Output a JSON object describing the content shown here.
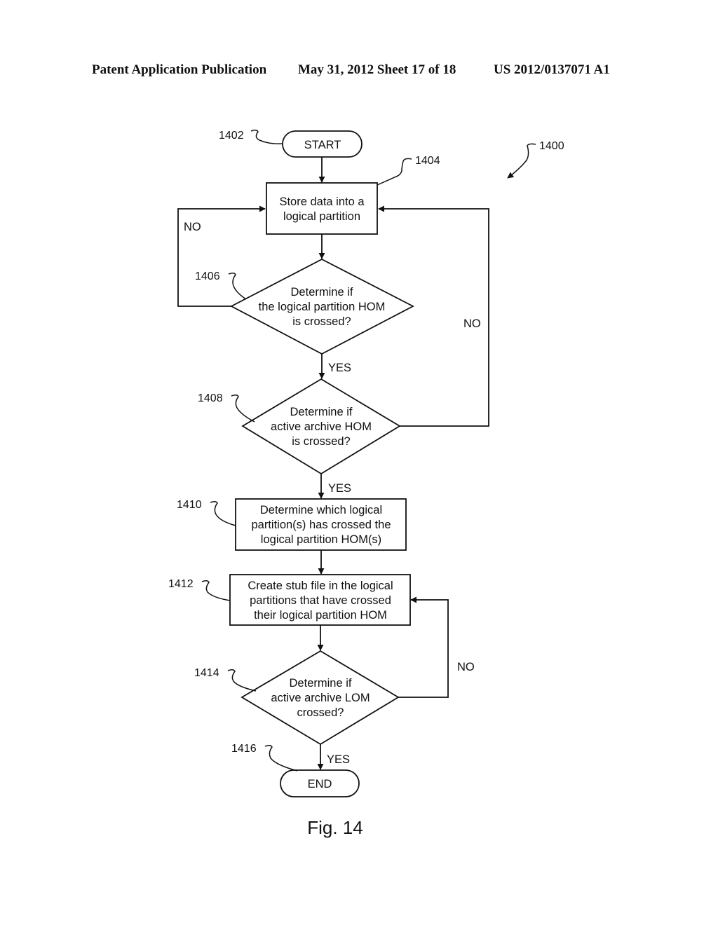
{
  "header": {
    "publication": "Patent Application Publication",
    "date_sheet": "May 31, 2012  Sheet 17 of 18",
    "number": "US 2012/0137071 A1"
  },
  "diagram": {
    "id": "1400",
    "figure_label": "Fig. 14",
    "nodes": {
      "start": {
        "ref": "1402",
        "shape": "terminal",
        "lines": [
          "START"
        ]
      },
      "store": {
        "ref": "1404",
        "shape": "process",
        "lines": [
          "Store data into a",
          "logical partition"
        ]
      },
      "check_lp": {
        "ref": "1406",
        "shape": "decision",
        "lines": [
          "Determine if",
          "the logical partition HOM",
          "is crossed?"
        ]
      },
      "check_aa_hom": {
        "ref": "1408",
        "shape": "decision",
        "lines": [
          "Determine if",
          "active archive HOM",
          "is crossed?"
        ]
      },
      "which_lp": {
        "ref": "1410",
        "shape": "process",
        "lines": [
          "Determine which logical",
          "partition(s) has crossed the",
          "logical partition HOM(s)"
        ]
      },
      "stub": {
        "ref": "1412",
        "shape": "process",
        "lines": [
          "Create stub file in the logical",
          "partitions that have crossed",
          "their logical partition HOM"
        ]
      },
      "check_aa_lom": {
        "ref": "1414",
        "shape": "decision",
        "lines": [
          "Determine if",
          "active archive LOM",
          "crossed?"
        ]
      },
      "end": {
        "ref": "1416",
        "shape": "terminal",
        "lines": [
          "END"
        ]
      }
    },
    "edges": [
      {
        "from": "start",
        "to": "store",
        "label": ""
      },
      {
        "from": "store",
        "to": "check_lp",
        "label": ""
      },
      {
        "from": "check_lp",
        "to": "store",
        "label": "NO"
      },
      {
        "from": "check_lp",
        "to": "check_aa_hom",
        "label": "YES"
      },
      {
        "from": "check_aa_hom",
        "to": "store",
        "label": "NO"
      },
      {
        "from": "check_aa_hom",
        "to": "which_lp",
        "label": "YES"
      },
      {
        "from": "which_lp",
        "to": "stub",
        "label": ""
      },
      {
        "from": "stub",
        "to": "check_aa_lom",
        "label": ""
      },
      {
        "from": "check_aa_lom",
        "to": "stub",
        "label": "NO"
      },
      {
        "from": "check_aa_lom",
        "to": "end",
        "label": "YES"
      }
    ]
  }
}
